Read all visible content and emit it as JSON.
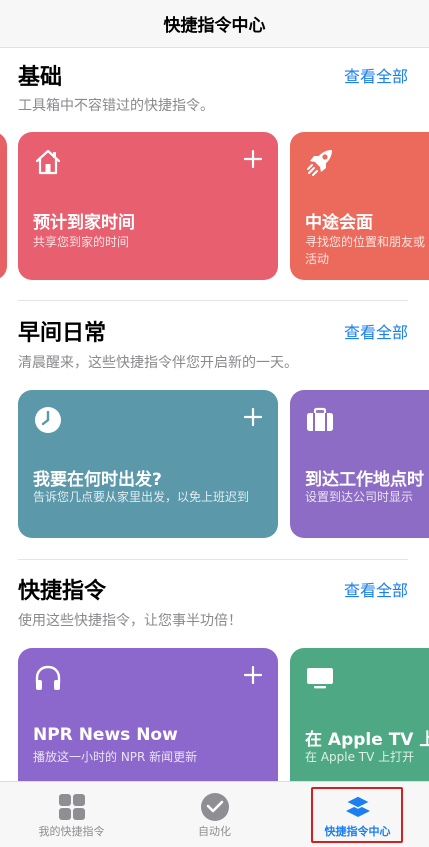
{
  "navbar": {
    "title": "快捷指令中心"
  },
  "sections": [
    {
      "title": "基础",
      "see_all": "查看全部",
      "subtitle": "工具箱中不容错过的快捷指令。",
      "cards": [
        {
          "title": "预计到家时间",
          "subtitle": "共享您到家的时间",
          "color": "#e8606f",
          "icon": "house-icon"
        },
        {
          "title": "中途会面",
          "subtitle": "寻找您的位置和朋友或活动",
          "color": "#ec6a5c",
          "icon": "rocket-icon"
        }
      ]
    },
    {
      "title": "早间日常",
      "see_all": "查看全部",
      "subtitle": "清晨醒来，这些快捷指令伴您开启新的一天。",
      "cards": [
        {
          "title": "我要在何时出发?",
          "subtitle": "告诉您几点要从家里出发，以免上班迟到",
          "color": "#5a98aa",
          "icon": "clock-icon"
        },
        {
          "title": "到达工作地点时",
          "subtitle": "设置到达公司时显示",
          "color": "#8c6cc4",
          "icon": "briefcase-icon"
        }
      ]
    },
    {
      "title": "快捷指令",
      "see_all": "查看全部",
      "subtitle": "使用这些快捷指令，让您事半功倍！",
      "cards": [
        {
          "title": "NPR News Now",
          "subtitle": "播放这一小时的 NPR 新闻更新",
          "color": "#8c67cc",
          "icon": "headphones-icon"
        },
        {
          "title": "在 Apple TV 上",
          "subtitle": "在 Apple TV 上打开",
          "color": "#4ea883",
          "icon": "tv-icon"
        }
      ]
    }
  ],
  "tabbar": {
    "tabs": [
      {
        "label": "我的快捷指令",
        "icon": "grid-icon"
      },
      {
        "label": "自动化",
        "icon": "check-circle-icon"
      },
      {
        "label": "快捷指令中心",
        "icon": "layers-icon",
        "active": true
      }
    ]
  },
  "colors": {
    "accent": "#1a7ff0",
    "highlight": "#d42020"
  }
}
